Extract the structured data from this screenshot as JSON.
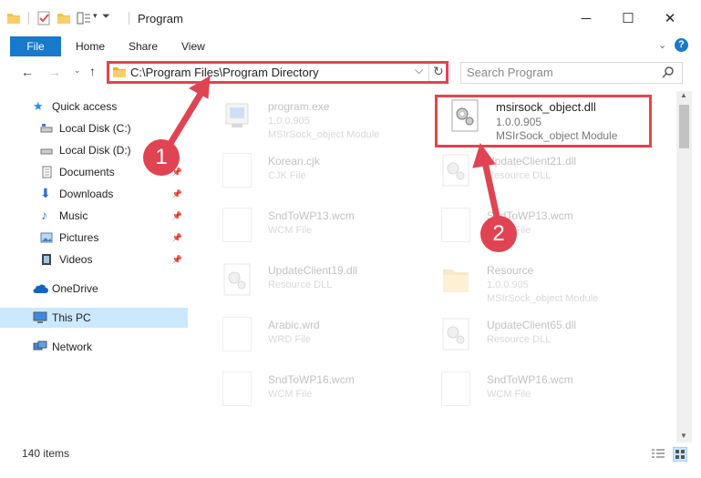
{
  "window": {
    "title": "Program",
    "controls": {
      "minimize": "─",
      "maximize": "☐",
      "close": "✕"
    }
  },
  "ribbon": {
    "tabs": [
      "File",
      "Home",
      "Share",
      "View"
    ],
    "help": "?"
  },
  "address": {
    "path": "C:\\Program Files\\Program Directory",
    "refresh": "↻",
    "dropdown": "⌵"
  },
  "search": {
    "placeholder": "Search Program"
  },
  "sidebar": {
    "items": [
      {
        "label": "Quick access",
        "icon": "star-icon"
      },
      {
        "label": "Local Disk (C:)",
        "icon": "drive-icon"
      },
      {
        "label": "Local Disk (D:)",
        "icon": "drive-icon"
      },
      {
        "label": "Documents",
        "icon": "documents-icon"
      },
      {
        "label": "Downloads",
        "icon": "download-icon"
      },
      {
        "label": "Music",
        "icon": "music-icon"
      },
      {
        "label": "Pictures",
        "icon": "pictures-icon"
      },
      {
        "label": "Videos",
        "icon": "videos-icon"
      },
      {
        "label": "OneDrive",
        "icon": "cloud-icon"
      },
      {
        "label": "This PC",
        "icon": "computer-icon"
      },
      {
        "label": "Network",
        "icon": "network-icon"
      }
    ]
  },
  "files": [
    {
      "name": "program.exe",
      "line1": "1.0.0.905",
      "line2": "MSIrSock_object Module"
    },
    {
      "name": "msirsock_object.dll",
      "line1": "1.0.0.905",
      "line2": "MSIrSock_object Module"
    },
    {
      "name": "Korean.cjk",
      "line1": "CJK File",
      "line2": ""
    },
    {
      "name": "UpdateClient21.dll",
      "line1": "Resource DLL",
      "line2": ""
    },
    {
      "name": "SndToWP13.wcm",
      "line1": "WCM File",
      "line2": ""
    },
    {
      "name": "SndToWP13.wcm",
      "line1": "WCM File",
      "line2": ""
    },
    {
      "name": "UpdateClient19.dll",
      "line1": "Resource DLL",
      "line2": ""
    },
    {
      "name": "Resource",
      "line1": "1.0.0.905",
      "line2": "MSIrSock_object Module"
    },
    {
      "name": "Arabic.wrd",
      "line1": "WRD File",
      "line2": ""
    },
    {
      "name": "UpdateClient65.dll",
      "line1": "Resource DLL",
      "line2": ""
    },
    {
      "name": "SndToWP16.wcm",
      "line1": "WCM File",
      "line2": ""
    },
    {
      "name": "SndToWP16.wcm",
      "line1": "WCM File",
      "line2": ""
    }
  ],
  "status": {
    "count": "140 items"
  },
  "annotations": {
    "badge1": "1",
    "badge2": "2"
  },
  "colors": {
    "accent": "#1979ca",
    "highlight": "#e04452",
    "selected": "#cce8ff"
  }
}
